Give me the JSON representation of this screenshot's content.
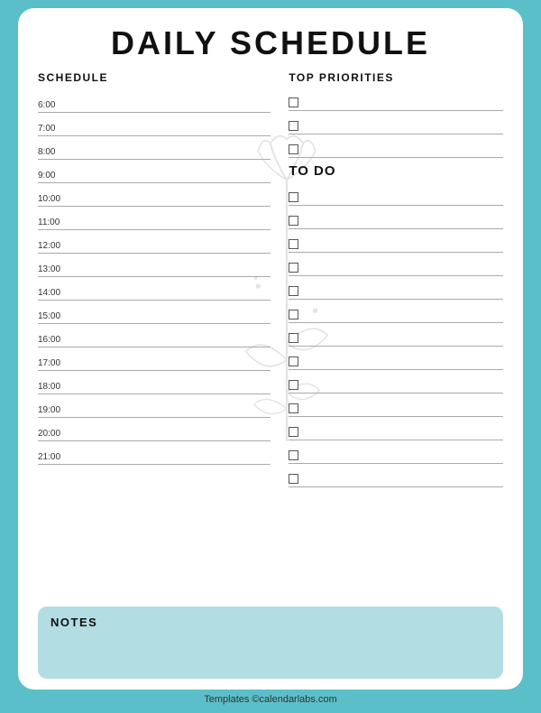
{
  "title": "DAILY SCHEDULE",
  "schedule": {
    "header": "SCHEDULE",
    "times": [
      "6:00",
      "7:00",
      "8:00",
      "9:00",
      "10:00",
      "11:00",
      "12:00",
      "13:00",
      "14:00",
      "15:00",
      "16:00",
      "17:00",
      "18:00",
      "19:00",
      "20:00",
      "21:00"
    ]
  },
  "priorities": {
    "header": "TOP PRIORITIES",
    "count": 3
  },
  "todo": {
    "header": "TO DO",
    "count": 13
  },
  "notes": {
    "header": "NOTES"
  },
  "footer": "Templates ©calendarlabs.com"
}
